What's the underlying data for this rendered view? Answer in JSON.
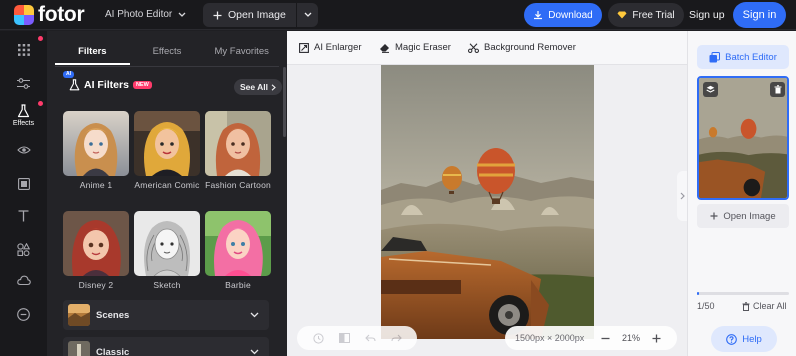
{
  "brand": {
    "name": "fotor"
  },
  "topbar": {
    "app_menu": "AI Photo Editor",
    "open_image": "Open Image",
    "download": "Download",
    "free_trial": "Free Trial",
    "sign_up": "Sign up",
    "sign_in": "Sign in"
  },
  "rail": {
    "items": [
      {
        "icon": "grid-icon",
        "label": ""
      },
      {
        "icon": "sliders-icon",
        "label": ""
      },
      {
        "icon": "flask-icon",
        "label": "Effects",
        "active": true
      },
      {
        "icon": "eye-icon",
        "label": ""
      },
      {
        "icon": "frame-icon",
        "label": ""
      },
      {
        "icon": "text-icon",
        "label": ""
      },
      {
        "icon": "elements-icon",
        "label": ""
      },
      {
        "icon": "cloud-icon",
        "label": ""
      },
      {
        "icon": "more-icon",
        "label": ""
      }
    ]
  },
  "panel": {
    "tabs": [
      "Filters",
      "Effects",
      "My Favorites"
    ],
    "active_tab": "Filters",
    "ai_badge": "AI",
    "ai_title": "AI Filters",
    "new_badge": "NEW",
    "see_all": "See All",
    "filters": [
      {
        "name": "Anime 1"
      },
      {
        "name": "American Comic"
      },
      {
        "name": "Fashion Cartoon"
      },
      {
        "name": "Disney 2"
      },
      {
        "name": "Sketch"
      },
      {
        "name": "Barbie"
      }
    ],
    "categories": [
      "Scenes",
      "Classic"
    ]
  },
  "canvas": {
    "tools": [
      "AI Enlarger",
      "Magic Eraser",
      "Background Remover"
    ],
    "dimensions": "1500px × 2000px",
    "zoom": "21%"
  },
  "right": {
    "batch_editor": "Batch Editor",
    "open_image": "Open Image",
    "counter": "1/50",
    "progress": 0.02,
    "clear_all": "Clear All",
    "help": "Help"
  },
  "colors": {
    "accent": "#2f6cf6",
    "new_badge": "#ff3b6b",
    "dark_bg": "#19191c",
    "panel_bg": "#232327"
  }
}
